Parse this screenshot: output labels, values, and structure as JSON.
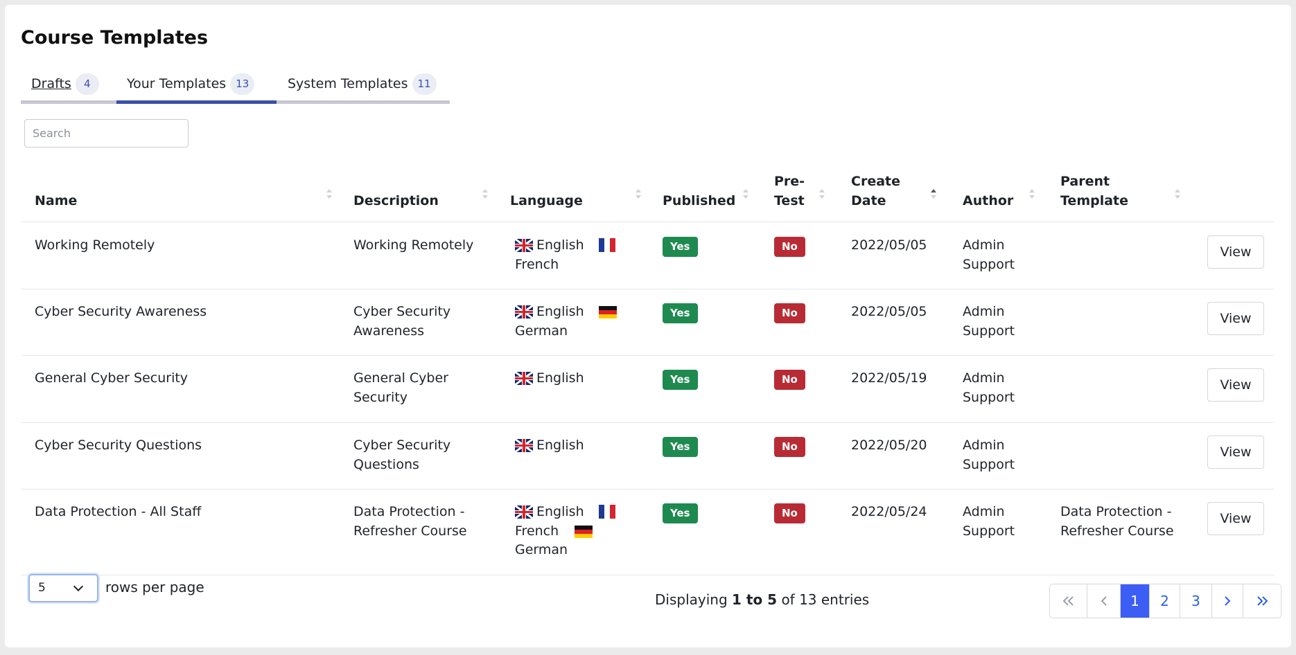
{
  "page": {
    "title": "Course Templates"
  },
  "tabs": [
    {
      "label": "Drafts",
      "count": "4"
    },
    {
      "label": "Your Templates",
      "count": "13"
    },
    {
      "label": "System Templates",
      "count": "11"
    }
  ],
  "active_tab": "Your Templates",
  "search": {
    "placeholder": "Search",
    "value": ""
  },
  "table": {
    "columns": [
      "Name",
      "Description",
      "Language",
      "Published",
      "Pre-Test",
      "Create Date",
      "Author",
      "Parent Template"
    ],
    "column_lines": {
      "pretest": [
        "Pre-",
        "Test"
      ],
      "create_date": [
        "Create",
        "Date"
      ],
      "parent_template": [
        "Parent",
        "Template"
      ]
    },
    "sorted_by": "Create Date",
    "rows": [
      {
        "name": "Working Remotely",
        "description": [
          "Working Remotely"
        ],
        "languages": [
          "English",
          "French"
        ],
        "published": "Yes",
        "pretest": "No",
        "create_date": "2022/05/05",
        "author": [
          "Admin",
          "Support"
        ],
        "parent": [
          "",
          ""
        ],
        "action": "View"
      },
      {
        "name": "Cyber Security Awareness",
        "description": [
          "Cyber Security",
          "Awareness"
        ],
        "languages": [
          "English",
          "German"
        ],
        "published": "Yes",
        "pretest": "No",
        "create_date": "2022/05/05",
        "author": [
          "Admin",
          "Support"
        ],
        "parent": [
          "",
          ""
        ],
        "action": "View"
      },
      {
        "name": "General Cyber Security",
        "description": [
          "General Cyber",
          "Security"
        ],
        "languages": [
          "English"
        ],
        "published": "Yes",
        "pretest": "No",
        "create_date": "2022/05/19",
        "author": [
          "Admin",
          "Support"
        ],
        "parent": [
          "",
          ""
        ],
        "action": "View"
      },
      {
        "name": "Cyber Security Questions",
        "description": [
          "Cyber Security",
          "Questions"
        ],
        "languages": [
          "English"
        ],
        "published": "Yes",
        "pretest": "No",
        "create_date": "2022/05/20",
        "author": [
          "Admin",
          "Support"
        ],
        "parent": [
          "",
          ""
        ],
        "action": "View"
      },
      {
        "name": "Data Protection - All Staff",
        "description": [
          "Data Protection -",
          "Refresher Course"
        ],
        "languages": [
          "English",
          "French",
          "German"
        ],
        "published": "Yes",
        "pretest": "No",
        "create_date": "2022/05/24",
        "author": [
          "Admin",
          "Support"
        ],
        "parent": [
          "Data Protection -",
          "Refresher Course"
        ],
        "action": "View"
      }
    ]
  },
  "footer": {
    "rows_per_page_value": "5",
    "rows_per_page_label": "rows per page",
    "display_prefix": "Displaying",
    "display_range": "1 to 5",
    "display_suffix": "of 13 entries",
    "pages": [
      "1",
      "2",
      "3"
    ],
    "current_page": "1",
    "pager_icons": {
      "first": "double-chevron-left-icon",
      "prev": "chevron-left-icon",
      "next": "chevron-right-icon",
      "last": "double-chevron-right-icon"
    }
  },
  "colors": {
    "active_tab": "#3d4ea8",
    "published_yes": "#1e8a50",
    "pretest_no": "#b92b34",
    "page_active": "#3d5ef5",
    "link": "#2a5fe8"
  }
}
